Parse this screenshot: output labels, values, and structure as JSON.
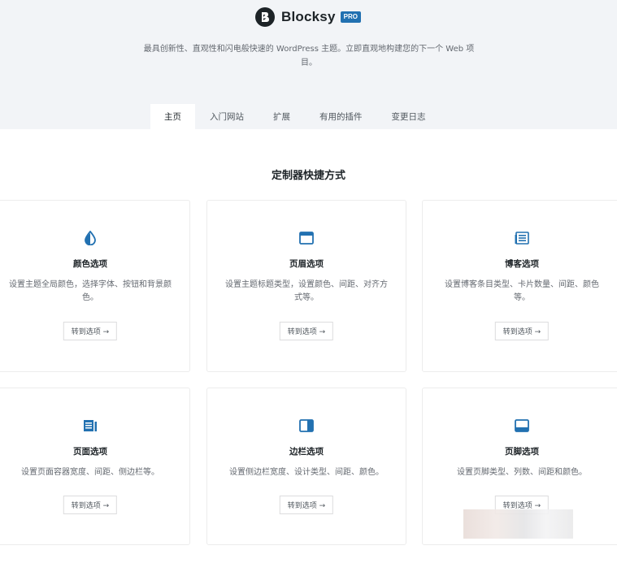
{
  "header": {
    "brand_name": "Blocksy",
    "badge": "PRO",
    "tagline": "最具创新性、直观性和闪电般快速的 WordPress 主题。立即直观地构建您的下一个 Web 项目。"
  },
  "tabs": [
    {
      "label": "主页",
      "active": true
    },
    {
      "label": "入门网站",
      "active": false
    },
    {
      "label": "扩展",
      "active": false
    },
    {
      "label": "有用的插件",
      "active": false
    },
    {
      "label": "变更日志",
      "active": false
    }
  ],
  "section": {
    "title": "定制器快捷方式"
  },
  "cards": [
    {
      "icon": "droplet-icon",
      "title": "颜色选项",
      "desc": "设置主题全局颜色，选择字体、按钮和背景颜色。",
      "button": "转到选项 →"
    },
    {
      "icon": "window-icon",
      "title": "页眉选项",
      "desc": "设置主题标题类型，设置颜色、间距、对齐方式等。",
      "button": "转到选项 →"
    },
    {
      "icon": "blog-icon",
      "title": "博客选项",
      "desc": "设置博客条目类型、卡片数量、间距、颜色等。",
      "button": "转到选项 →"
    },
    {
      "icon": "page-icon",
      "title": "页面选项",
      "desc": "设置页面容器宽度、间距、侧边栏等。",
      "button": "转到选项 →"
    },
    {
      "icon": "sidebar-icon",
      "title": "边栏选项",
      "desc": "设置侧边栏宽度、设计类型、间距、颜色。",
      "button": "转到选项 →"
    },
    {
      "icon": "footer-icon",
      "title": "页脚选项",
      "desc": "设置页脚类型、列数、间距和颜色。",
      "button": "转到选项 →"
    }
  ],
  "colors": {
    "accent": "#2271b1",
    "header_bg": "#f2f4f7",
    "text_dark": "#1d2327"
  }
}
